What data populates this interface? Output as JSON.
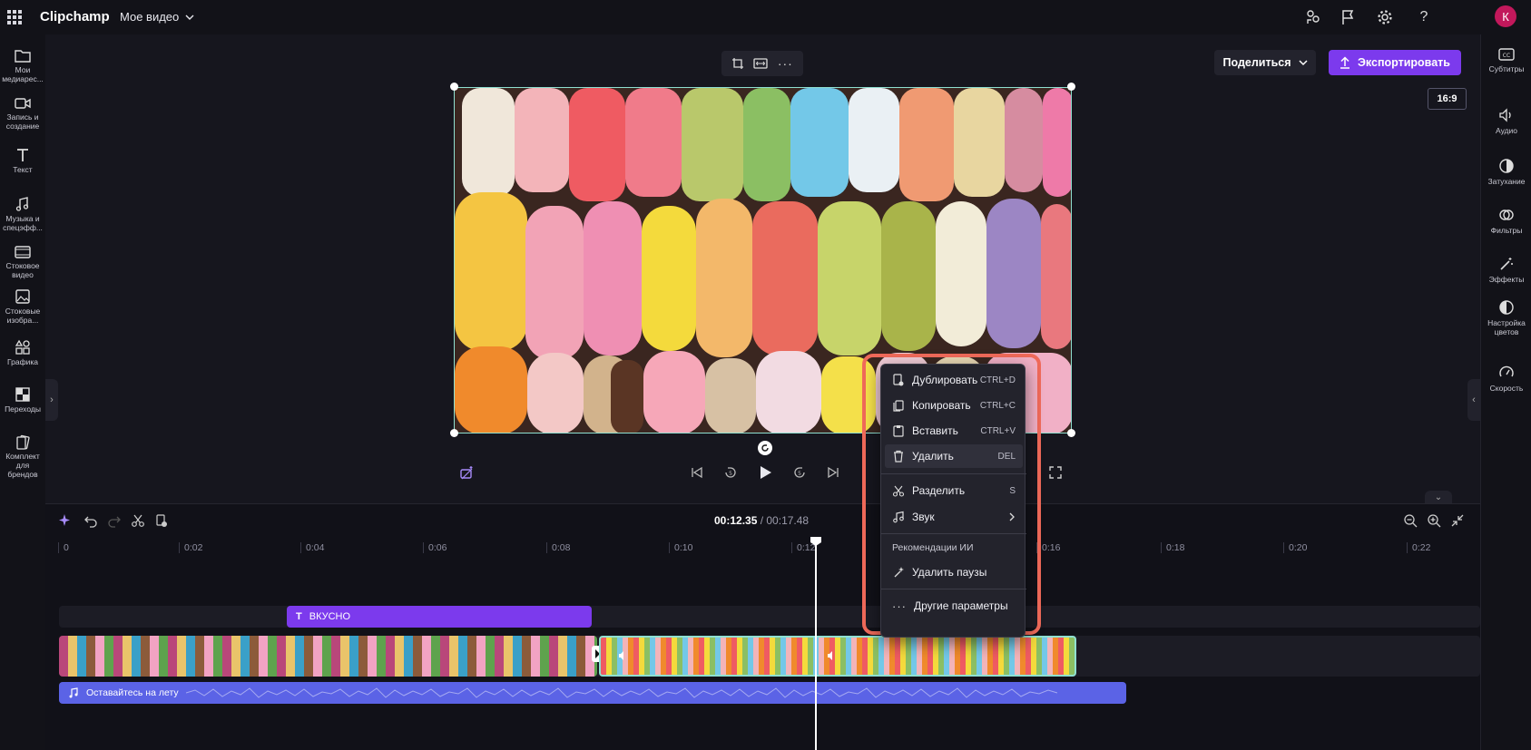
{
  "app": {
    "brand": "Clipchamp",
    "project_title": "Мое видео"
  },
  "topbar": {
    "avatar_letter": "К"
  },
  "left_rail": [
    {
      "id": "media",
      "label": "Мои медиарес..."
    },
    {
      "id": "record",
      "label": "Запись и создание"
    },
    {
      "id": "text",
      "label": "Текст"
    },
    {
      "id": "music",
      "label": "Музыка и спецэфф..."
    },
    {
      "id": "stock-video",
      "label": "Стоковое видео"
    },
    {
      "id": "stock-images",
      "label": "Стоковые изобра..."
    },
    {
      "id": "graphics",
      "label": "Графика"
    },
    {
      "id": "transitions",
      "label": "Переходы"
    },
    {
      "id": "brand-kit",
      "label": "Комплект для брендов"
    }
  ],
  "right_rail": [
    {
      "id": "subtitles",
      "label": "Субтитры"
    },
    {
      "id": "audio",
      "label": "Аудио"
    },
    {
      "id": "fade",
      "label": "Затухание"
    },
    {
      "id": "filters",
      "label": "Фильтры"
    },
    {
      "id": "effects",
      "label": "Эффекты"
    },
    {
      "id": "color",
      "label": "Настройка цветов"
    },
    {
      "id": "speed",
      "label": "Скорость"
    }
  ],
  "header": {
    "share_label": "Поделиться",
    "export_label": "Экспортировать",
    "aspect_ratio": "16:9"
  },
  "timeline": {
    "current_time": "00:12.35",
    "total_time": "/ 00:17.48",
    "ticks": [
      "0",
      "0:02",
      "0:04",
      "0:06",
      "0:08",
      "0:10",
      "0:12",
      "0:16",
      "0:18",
      "0:20",
      "0:22"
    ],
    "text_clip_label": "ВКУСНО",
    "audio_clip_label": "Оставайтесь на лету"
  },
  "context_menu": {
    "items": [
      {
        "id": "duplicate",
        "label": "Дублировать",
        "shortcut": "CTRL+D"
      },
      {
        "id": "copy",
        "label": "Копировать",
        "shortcut": "CTRL+C"
      },
      {
        "id": "paste",
        "label": "Вставить",
        "shortcut": "CTRL+V"
      },
      {
        "id": "delete",
        "label": "Удалить",
        "shortcut": "DEL"
      },
      {
        "id": "split",
        "label": "Разделить",
        "shortcut": "S"
      },
      {
        "id": "sound",
        "label": "Звук",
        "shortcut": ""
      }
    ],
    "ai_section_title": "Рекомендации ИИ",
    "ai_items": [
      {
        "id": "remove-pauses",
        "label": "Удалить паузы"
      }
    ],
    "more_label": "Другие параметры"
  },
  "colors": {
    "accent": "#7c3aed",
    "audio": "#5b63e6",
    "highlight": "#f06a5a",
    "selection": "#8fe0d1"
  }
}
